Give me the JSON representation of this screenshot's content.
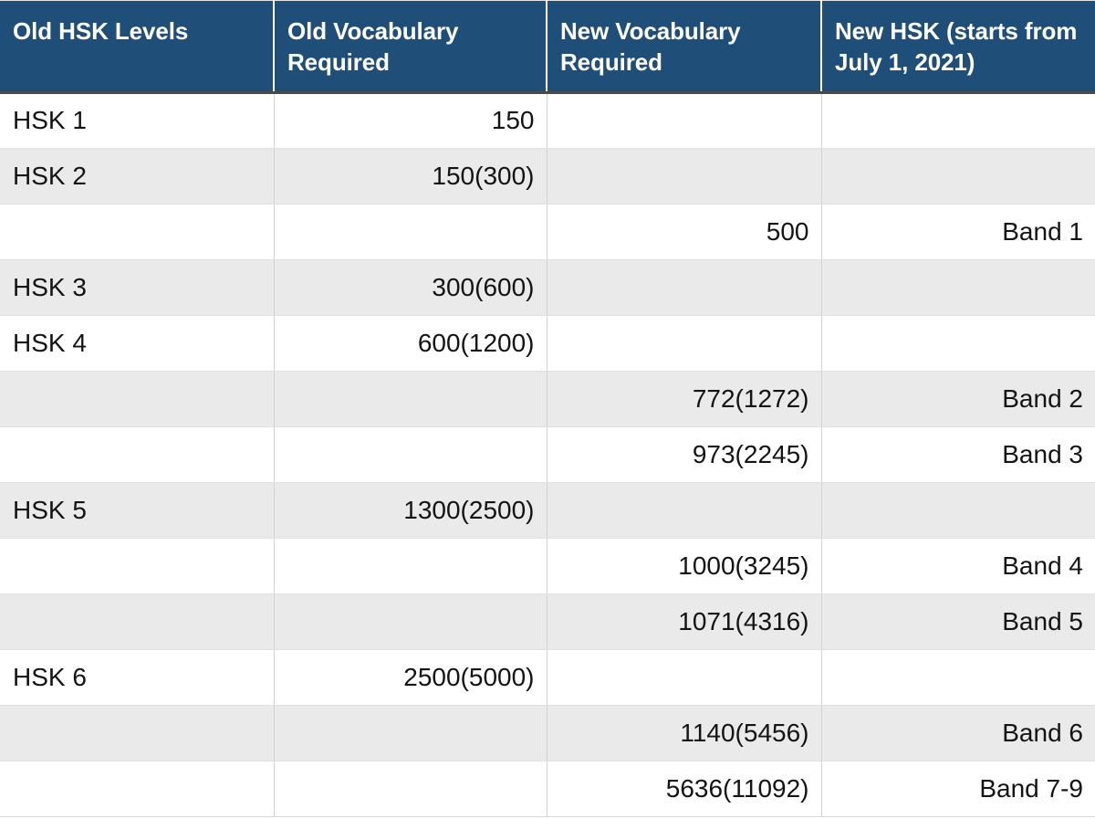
{
  "table": {
    "accent_header_bg": "#1F4E79",
    "header_text_color": "#FFFFFF",
    "zebra_row_bg": "#EAEAEA",
    "columns": [
      {
        "key": "old_level",
        "label": "Old HSK Levels",
        "align": "left"
      },
      {
        "key": "old_vocab",
        "label": "Old Vocabulary Required",
        "align": "right"
      },
      {
        "key": "new_vocab",
        "label": "New Vocabulary Required",
        "align": "right"
      },
      {
        "key": "new_level",
        "label": "New HSK (starts from July 1, 2021)",
        "align": "right"
      }
    ],
    "rows": [
      {
        "old_level": "HSK 1",
        "old_vocab": "150",
        "new_vocab": "",
        "new_level": ""
      },
      {
        "old_level": "HSK 2",
        "old_vocab": "150(300)",
        "new_vocab": "",
        "new_level": ""
      },
      {
        "old_level": "",
        "old_vocab": "",
        "new_vocab": "500",
        "new_level": "Band 1"
      },
      {
        "old_level": "HSK 3",
        "old_vocab": "300(600)",
        "new_vocab": "",
        "new_level": ""
      },
      {
        "old_level": "HSK 4",
        "old_vocab": "600(1200)",
        "new_vocab": "",
        "new_level": ""
      },
      {
        "old_level": "",
        "old_vocab": "",
        "new_vocab": "772(1272)",
        "new_level": "Band 2"
      },
      {
        "old_level": "",
        "old_vocab": "",
        "new_vocab": "973(2245)",
        "new_level": "Band 3"
      },
      {
        "old_level": "HSK 5",
        "old_vocab": "1300(2500)",
        "new_vocab": "",
        "new_level": ""
      },
      {
        "old_level": "",
        "old_vocab": "",
        "new_vocab": "1000(3245)",
        "new_level": "Band 4"
      },
      {
        "old_level": "",
        "old_vocab": "",
        "new_vocab": "1071(4316)",
        "new_level": "Band 5"
      },
      {
        "old_level": "HSK 6",
        "old_vocab": "2500(5000)",
        "new_vocab": "",
        "new_level": ""
      },
      {
        "old_level": "",
        "old_vocab": "",
        "new_vocab": "1140(5456)",
        "new_level": "Band 6"
      },
      {
        "old_level": "",
        "old_vocab": "",
        "new_vocab": "5636(11092)",
        "new_level": "Band 7-9"
      }
    ]
  }
}
